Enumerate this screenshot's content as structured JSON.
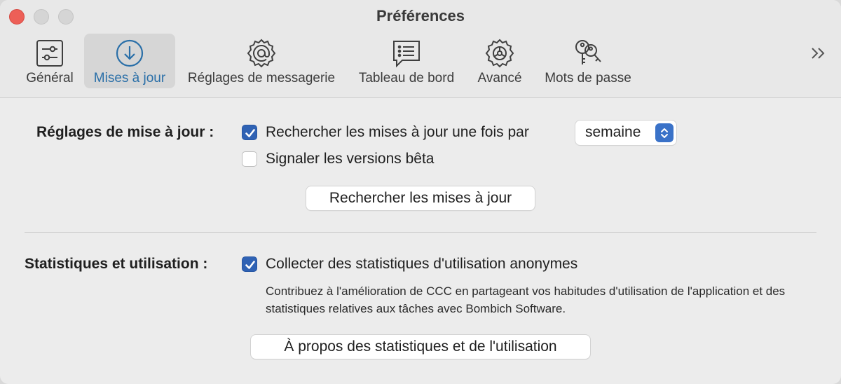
{
  "window": {
    "title": "Préférences"
  },
  "toolbar": {
    "tabs": [
      {
        "label": "Général",
        "icon": "sliders-icon"
      },
      {
        "label": "Mises à jour",
        "icon": "download-circle-icon",
        "selected": true
      },
      {
        "label": "Réglages de messagerie",
        "icon": "at-gear-icon"
      },
      {
        "label": "Tableau de bord",
        "icon": "list-bubble-icon"
      },
      {
        "label": "Avancé",
        "icon": "gear-icon"
      },
      {
        "label": "Mots de passe",
        "icon": "keys-icon"
      }
    ],
    "overflow_icon": "chevron-double-right-icon"
  },
  "updates": {
    "section_label": "Réglages de mise à jour :",
    "check_label": "Rechercher les mises à jour une fois par",
    "check_checked": true,
    "frequency_value": "semaine",
    "beta_label": "Signaler les versions bêta",
    "beta_checked": false,
    "check_now_button": "Rechercher les mises à jour"
  },
  "stats": {
    "section_label": "Statistiques et utilisation :",
    "collect_label": "Collecter des statistiques d'utilisation anonymes",
    "collect_checked": true,
    "note": "Contribuez à l'amélioration de CCC en partageant vos habitudes d'utilisation de l'application et des statistiques relatives aux tâches avec Bombich Software.",
    "about_button": "À propos des statistiques et de l'utilisation"
  },
  "colors": {
    "accent": "#2f62b4",
    "selected_tab_text": "#2a6fa8",
    "close": "#ed5f57"
  }
}
